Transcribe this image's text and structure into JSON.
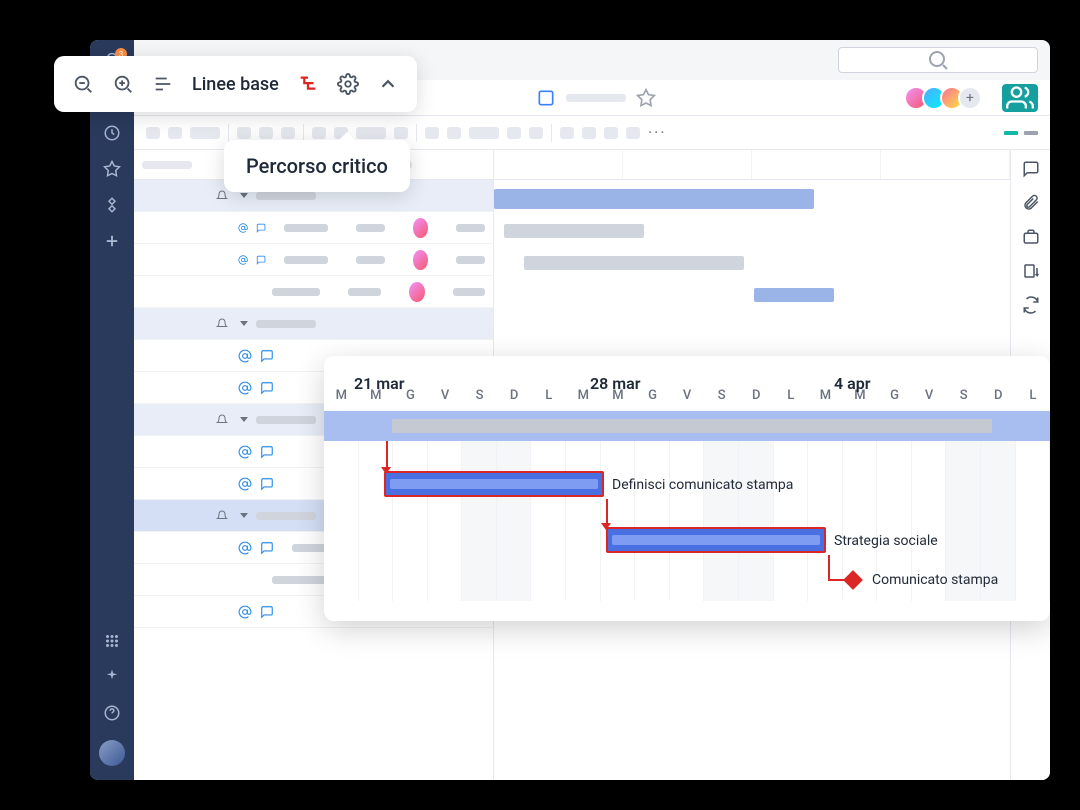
{
  "leftRail": {
    "notifCount": "3"
  },
  "floatToolbar": {
    "baselineLabel": "Linee base"
  },
  "tooltip": {
    "text": "Percorso critico"
  },
  "zoomPanel": {
    "dates": [
      "21 mar",
      "28 mar",
      "4 apr"
    ],
    "days": [
      "M",
      "M",
      "G",
      "V",
      "S",
      "D",
      "L",
      "M",
      "M",
      "G",
      "V",
      "S",
      "D",
      "L",
      "M",
      "M",
      "G",
      "V",
      "S",
      "D",
      "L"
    ],
    "task1Label": "Definisci comunicato stampa",
    "task2Label": "Strategia sociale",
    "milestoneLabel": "Comunicato stampa"
  },
  "colors": {
    "critical": "#dc2626",
    "taskBlue": "#4a6fe0",
    "summaryBlue": "#a8bef0",
    "teal": "#159f9f"
  }
}
